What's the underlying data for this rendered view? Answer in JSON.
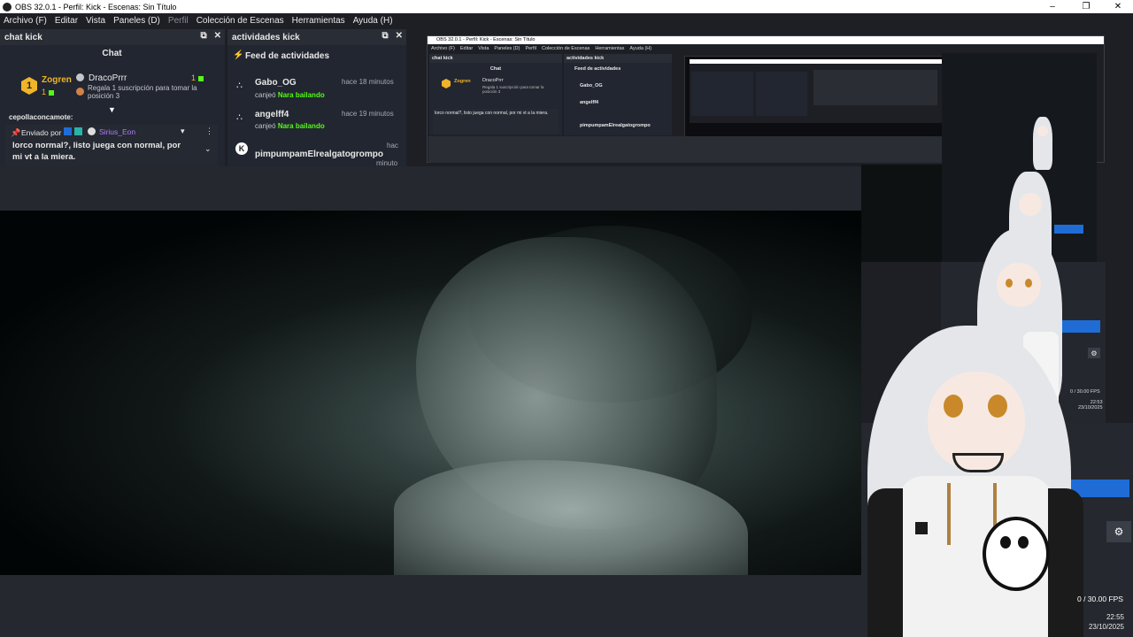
{
  "window": {
    "title": "OBS 32.0.1 - Perfil: Kick - Escenas: Sin Título"
  },
  "menu": [
    "Archivo (F)",
    "Editar",
    "Vista",
    "Paneles (D)",
    "Perfil",
    "Colección de Escenas",
    "Herramientas",
    "Ayuda (H)"
  ],
  "chat_dock": {
    "title": "chat kick",
    "header": "Chat",
    "gifter": {
      "rank": "1",
      "name": "Zogren",
      "count": "1"
    },
    "recipient": {
      "name": "DracoPrrr",
      "count": "1",
      "message": "Regala 1 suscripción para tomar la posición 3"
    },
    "partial_user": "cepollaconcamote:",
    "pinned": {
      "sent_by_label": "Enviado por",
      "user": "Sirius_Eon",
      "message": "lorco normal?, listo juega con normal, por mi vt a la miera."
    }
  },
  "activity_dock": {
    "title": "actividades kick",
    "header": "Feed de actividades",
    "items": [
      {
        "user": "Gabo_OG",
        "time": "hace 18 minutos",
        "action": "canjeó",
        "reward": "Nara bailando"
      },
      {
        "user": "angelff4",
        "time": "hace 19 minutos",
        "action": "canjeó",
        "reward": "Nara bailando"
      },
      {
        "user": "pimpumpamElrealgatogrompo",
        "time": "hac",
        "time2": "minuto"
      }
    ]
  },
  "nested_window": {
    "title": "OBS 32.0.1 - Perfil: Kick - Escenas: Sin Título",
    "menu": [
      "Archivo (F)",
      "Editar",
      "Vista",
      "Paneles (D)",
      "Perfil",
      "Colección de Escenas",
      "Herramientas",
      "Ayuda (H)"
    ]
  },
  "status": {
    "fps": "0 / 30.00 FPS",
    "time": "22:55",
    "date": "23/10/2025",
    "mini_fps": "0 / 30.00 FPS",
    "mini_time": "22:53",
    "mini_date": "23/10/2025"
  },
  "colors": {
    "kick_green": "#53fc18",
    "accent_blue": "#1f6cd6",
    "gift_gold": "#f0b429",
    "purple_user": "#b07cff"
  }
}
